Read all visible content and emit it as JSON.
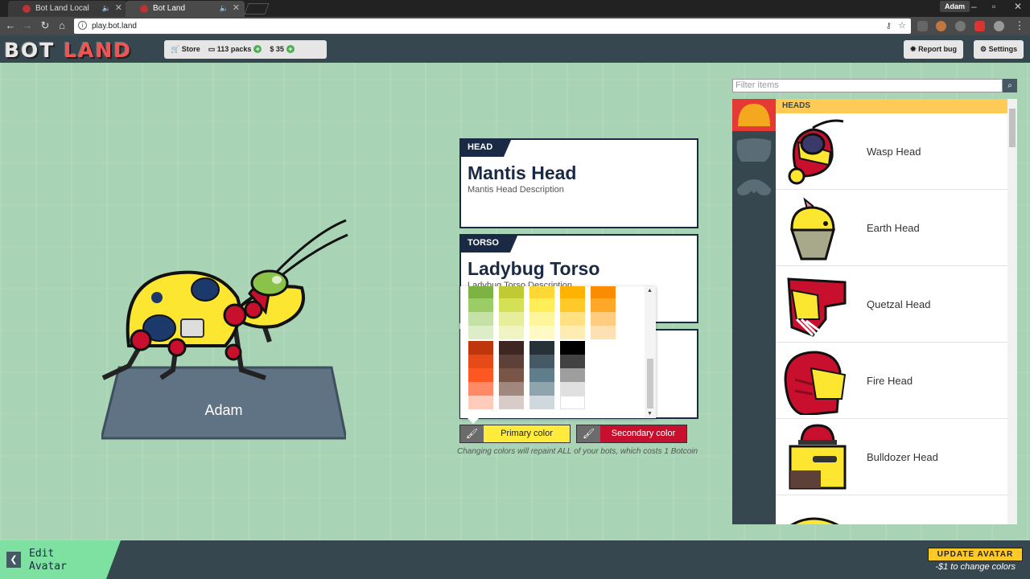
{
  "browser": {
    "tabs": [
      {
        "label": "Bot Land Local"
      },
      {
        "label": "Bot Land"
      }
    ],
    "user": "Adam",
    "url": "play.bot.land"
  },
  "header": {
    "logo_left": "BOT",
    "logo_right": "LAND",
    "store_label": "Store",
    "packs_label": "113 packs",
    "money_label": "35",
    "report_bug_label": "Report bug",
    "settings_label": "Settings"
  },
  "stage": {
    "avatar_name": "Adam"
  },
  "cards": {
    "head": {
      "tag": "HEAD",
      "title": "Mantis Head",
      "desc": "Mantis Head Description"
    },
    "torso": {
      "tag": "TORSO",
      "title": "Ladybug Torso",
      "desc": "Ladybug Torso Description"
    }
  },
  "colors": {
    "primary_label": "Primary color",
    "secondary_label": "Secondary color",
    "primary_color": "#ffeb3b",
    "secondary_color": "#c8102e",
    "note": "Changing colors will repaint ALL of your bots, which costs 1 Botcoin",
    "palette_rows": [
      [
        "#7cb342",
        "#c0ca33",
        "#fdd835",
        "#ffb300",
        "#fb8c00"
      ],
      [
        "#9ccc65",
        "#d4e157",
        "#ffee58",
        "#ffca28",
        "#ffa726"
      ],
      [
        "#c5e1a5",
        "#e6ee9c",
        "#fff59d",
        "#ffe082",
        "#ffcc80"
      ],
      [
        "#dcedc8",
        "#f0f4c3",
        "#fff9c4",
        "#ffecb3",
        "#ffe0b2"
      ],
      [
        "#bf360c",
        "#3e2723",
        "#263238",
        "#000000",
        null
      ],
      [
        "#e64a19",
        "#5d4037",
        "#455a64",
        "#424242",
        null
      ],
      [
        "#ff5722",
        "#795548",
        "#607d8b",
        "#9e9e9e",
        null
      ],
      [
        "#ff8a65",
        "#a1887f",
        "#90a4ae",
        "#e0e0e0",
        null
      ],
      [
        "#ffccbc",
        "#d7ccc8",
        "#cfd8dc",
        "#ffffff",
        null
      ]
    ]
  },
  "sidebar": {
    "filter_placeholder": "Filter items",
    "section": "HEADS",
    "items": [
      {
        "name": "Wasp Head"
      },
      {
        "name": "Earth Head"
      },
      {
        "name": "Quetzal Head"
      },
      {
        "name": "Fire Head"
      },
      {
        "name": "Bulldozer Head"
      }
    ]
  },
  "footer": {
    "edit_label": "Edit Avatar",
    "update_label": "UPDATE AVATAR",
    "update_note": "-$1 to change colors"
  }
}
